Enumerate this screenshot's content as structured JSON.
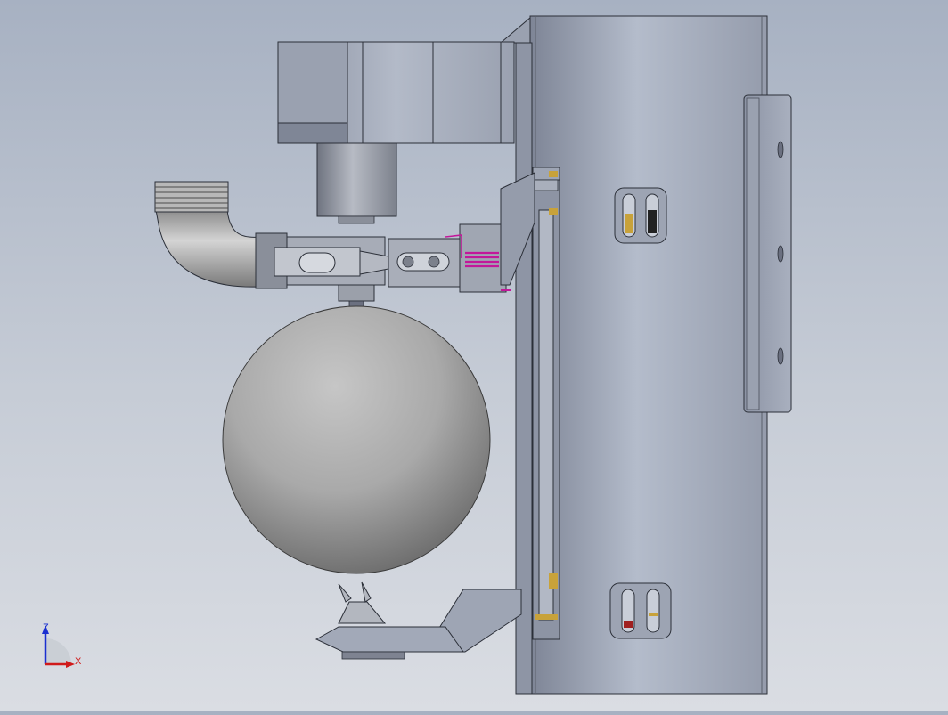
{
  "triad": {
    "z_label": "Z",
    "x_label": "X",
    "z_color": "#1a2fd0",
    "x_color": "#d01a1a"
  },
  "colors": {
    "background_top": "#a7b1c2",
    "background_bottom": "#dadde3",
    "body_metal": "#a4acbd",
    "spring": "#c2189a",
    "slot_marker_yellow": "#c8a23a",
    "slot_marker_dark": "#222222",
    "slot_marker_red": "#a02020"
  },
  "icons": {
    "coordinate_triad": "xz-axis-triad-icon"
  }
}
